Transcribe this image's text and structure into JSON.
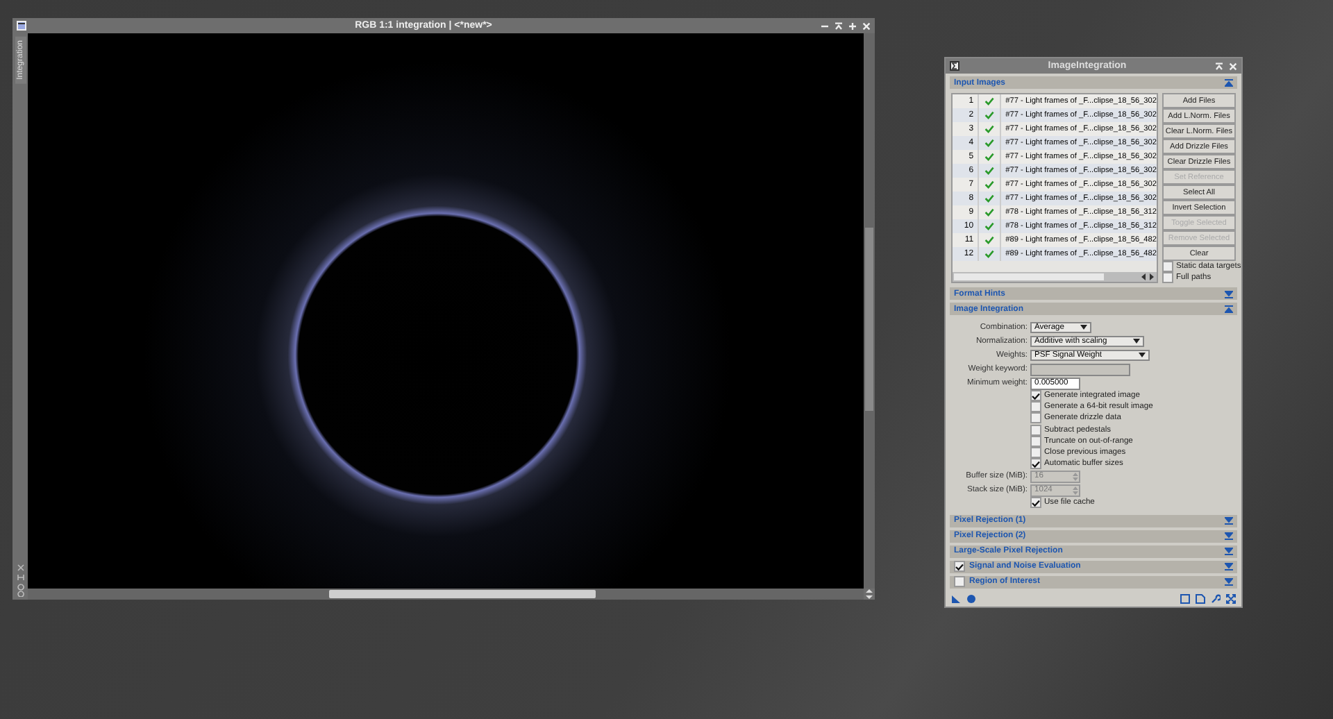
{
  "image_window": {
    "title": "RGB 1:1 integration | <*new*>",
    "side_tab": "Integration"
  },
  "panel": {
    "title": "ImageIntegration",
    "sections": [
      {
        "kind": "input_images",
        "title": "Input Images",
        "expanded": true
      },
      {
        "kind": "collapsed",
        "title": "Format Hints",
        "expanded": false
      },
      {
        "kind": "image_integration",
        "title": "Image Integration",
        "expanded": true
      },
      {
        "kind": "collapsed",
        "title": "Pixel Rejection (1)",
        "expanded": false
      },
      {
        "kind": "collapsed",
        "title": "Pixel Rejection (2)",
        "expanded": false
      },
      {
        "kind": "collapsed",
        "title": "Large-Scale Pixel Rejection",
        "expanded": false
      },
      {
        "kind": "collapsed",
        "title": "Signal and Noise Evaluation",
        "expanded": false,
        "checked": true
      },
      {
        "kind": "collapsed",
        "title": "Region of Interest",
        "expanded": false,
        "checked": false
      }
    ],
    "rows": [
      {
        "index": "1",
        "enabled": true,
        "file": "#77 - Light frames of _F...clipse_18_56_302"
      },
      {
        "index": "2",
        "enabled": true,
        "file": "#77 - Light frames of _F...clipse_18_56_302"
      },
      {
        "index": "3",
        "enabled": true,
        "file": "#77 - Light frames of _F...clipse_18_56_302"
      },
      {
        "index": "4",
        "enabled": true,
        "file": "#77 - Light frames of _F...clipse_18_56_302"
      },
      {
        "index": "5",
        "enabled": true,
        "file": "#77 - Light frames of _F...clipse_18_56_302"
      },
      {
        "index": "6",
        "enabled": true,
        "file": "#77 - Light frames of _F...clipse_18_56_302"
      },
      {
        "index": "7",
        "enabled": true,
        "file": "#77 - Light frames of _F...clipse_18_56_302"
      },
      {
        "index": "8",
        "enabled": true,
        "file": "#77 - Light frames of _F...clipse_18_56_302"
      },
      {
        "index": "9",
        "enabled": true,
        "file": "#78 - Light frames of _F...clipse_18_56_312"
      },
      {
        "index": "10",
        "enabled": true,
        "file": "#78 - Light frames of _F...clipse_18_56_312"
      },
      {
        "index": "11",
        "enabled": true,
        "file": "#89 - Light frames of _F...clipse_18_56_482"
      },
      {
        "index": "12",
        "enabled": true,
        "file": "#89 - Light frames of _F...clipse_18_56_482"
      }
    ],
    "buttons": [
      {
        "label": "Add Files",
        "disabled": false
      },
      {
        "label": "Add L.Norm. Files",
        "disabled": false
      },
      {
        "label": "Clear L.Norm. Files",
        "disabled": false
      },
      {
        "label": "Add Drizzle Files",
        "disabled": false
      },
      {
        "label": "Clear Drizzle Files",
        "disabled": false
      },
      {
        "label": "Set Reference",
        "disabled": true
      },
      {
        "label": "Select All",
        "disabled": false
      },
      {
        "label": "Invert Selection",
        "disabled": false
      },
      {
        "label": "Toggle Selected",
        "disabled": true
      },
      {
        "label": "Remove Selected",
        "disabled": true
      },
      {
        "label": "Clear",
        "disabled": false
      }
    ],
    "list_options": [
      {
        "label": "Static data targets",
        "checked": false
      },
      {
        "label": "Full paths",
        "checked": false
      }
    ],
    "fields": [
      {
        "kind": "select",
        "label": "Combination:",
        "value": "Average"
      },
      {
        "kind": "select",
        "label": "Normalization:",
        "value": "Additive with scaling"
      },
      {
        "kind": "select",
        "label": "Weights:",
        "value": "PSF Signal Weight"
      },
      {
        "kind": "text",
        "label": "Weight keyword:",
        "disabled": true
      },
      {
        "kind": "text",
        "label": "Minimum weight:",
        "value": "0.005000",
        "disabled": false
      },
      {
        "kind": "check",
        "label": "Generate integrated image",
        "checked": true
      },
      {
        "kind": "check",
        "label": "Generate a 64-bit result image",
        "checked": false
      },
      {
        "kind": "check",
        "label": "Generate drizzle data",
        "checked": false
      },
      {
        "kind": "check",
        "label": "Subtract pedestals",
        "checked": false
      },
      {
        "kind": "check",
        "label": "Truncate on out-of-range",
        "checked": false
      },
      {
        "kind": "check",
        "label": "Close previous images",
        "checked": false
      },
      {
        "kind": "check",
        "label": "Automatic buffer sizes",
        "checked": true
      },
      {
        "kind": "spin",
        "label": "Buffer size (MiB):",
        "value": "16",
        "disabled": true
      },
      {
        "kind": "spin",
        "label": "Stack size (MiB):",
        "value": "1024",
        "disabled": true
      },
      {
        "kind": "check",
        "label": "Use file cache",
        "checked": true
      }
    ]
  }
}
